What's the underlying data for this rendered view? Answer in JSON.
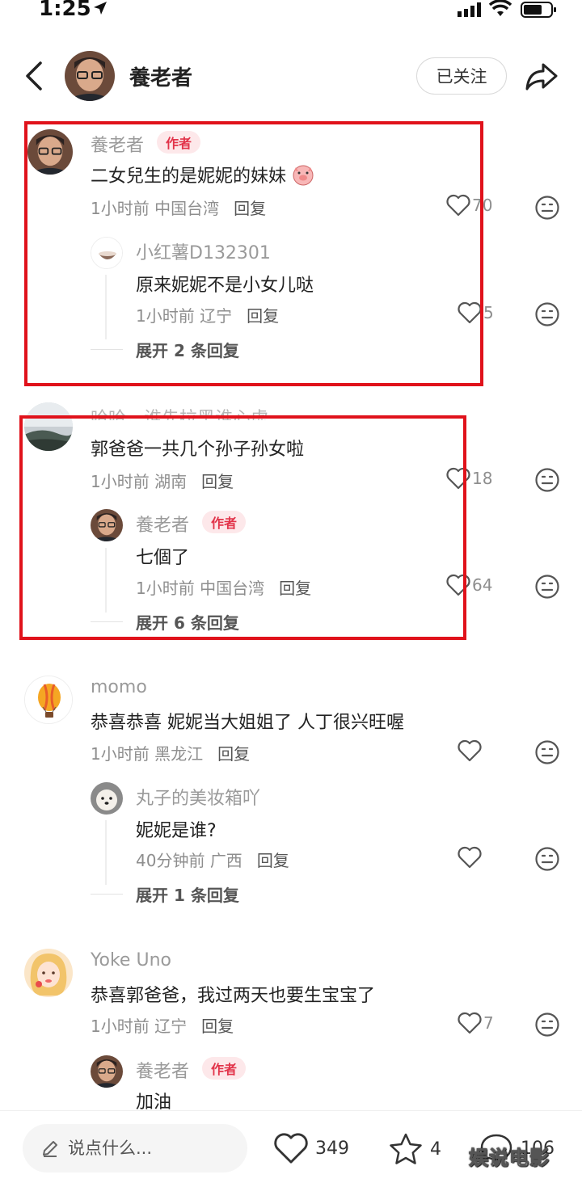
{
  "status_bar": {
    "time": "1:25"
  },
  "header": {
    "title": "養老者",
    "follow_label": "已关注"
  },
  "comments": [
    {
      "username": "養老者",
      "badge": "作者",
      "text": "二女兒生的是妮妮的妹妹",
      "time": "1小时前",
      "location": "中国台湾",
      "reply_label": "回复",
      "likes": "70",
      "replies": [
        {
          "username": "小红薯D132301",
          "text": "原来妮妮不是小女儿哒",
          "time": "1小时前",
          "location": "辽宁",
          "reply_label": "回复",
          "likes": "5"
        }
      ],
      "expand_label": "展开 2 条回复"
    },
    {
      "username": "哈哈，谁先拉黑谁心虚",
      "text": "郭爸爸一共几个孙子孙女啦",
      "time": "1小时前",
      "location": "湖南",
      "reply_label": "回复",
      "likes": "18",
      "replies": [
        {
          "username": "養老者",
          "badge": "作者",
          "text": "七個了",
          "time": "1小时前",
          "location": "中国台湾",
          "reply_label": "回复",
          "likes": "64"
        }
      ],
      "expand_label": "展开 6 条回复"
    },
    {
      "username": "momo",
      "text": "恭喜恭喜 妮妮当大姐姐了 人丁很兴旺喔",
      "time": "1小时前",
      "location": "黑龙江",
      "reply_label": "回复",
      "replies": [
        {
          "username": "丸子的美妆箱吖",
          "text": "妮妮是谁?",
          "time": "40分钟前",
          "location": "广西",
          "reply_label": "回复"
        }
      ],
      "expand_label": "展开 1 条回复"
    },
    {
      "username": "Yoke Uno",
      "text": "恭喜郭爸爸，我过两天也要生宝宝了",
      "time": "1小时前",
      "location": "辽宁",
      "reply_label": "回复",
      "likes": "7",
      "replies": [
        {
          "username": "養老者",
          "badge": "作者",
          "text": "加油"
        }
      ]
    }
  ],
  "bottom_bar": {
    "placeholder": "说点什么...",
    "likes": "349",
    "stars": "4",
    "comments": "106",
    "watermark": "娱说电影"
  },
  "colors": {
    "author_badge_bg": "#fde8ea",
    "author_badge_text": "#e2344a",
    "highlight_frame": "#e0121b"
  },
  "icons": [
    "location-arrow-icon",
    "signal-icon",
    "wifi-icon",
    "battery-icon",
    "back-chevron-icon",
    "share-icon",
    "heart-icon",
    "dislike-face-icon",
    "pencil-icon",
    "star-icon",
    "comment-bubble-icon"
  ]
}
